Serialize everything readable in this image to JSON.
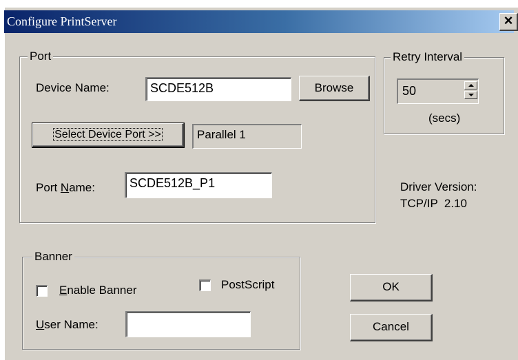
{
  "window": {
    "title": "Configure PrintServer",
    "close_glyph": "×"
  },
  "port_group": {
    "legend": "Port",
    "device_name_label": "Device Name:",
    "device_name_value": "SCDE512B",
    "browse_label": "Browse",
    "select_port_label": "Select Device Port >>",
    "selected_port_value": "Parallel 1",
    "port_name_label_prefix": "Port ",
    "port_name_label_mnemonic": "N",
    "port_name_label_suffix": "ame:",
    "port_name_value": "SCDE512B_P1"
  },
  "retry_group": {
    "legend": "Retry Interval",
    "value": "50",
    "unit": "(secs)"
  },
  "driver": {
    "version_label": "Driver Version:",
    "version_value": "TCP/IP  2.10"
  },
  "banner_group": {
    "legend": "Banner",
    "enable_banner_mnemonic": "E",
    "enable_banner_rest": "nable Banner",
    "enable_banner_checked": false,
    "postscript_label": "PostScript",
    "postscript_checked": false,
    "user_name_mnemonic": "U",
    "user_name_rest": "ser Name:",
    "user_name_value": ""
  },
  "buttons": {
    "ok_label": "OK",
    "cancel_label": "Cancel"
  },
  "colors": {
    "dialog_face": "#d4d0c8",
    "titlebar_start": "#0a246a",
    "titlebar_end": "#a6caf0"
  }
}
